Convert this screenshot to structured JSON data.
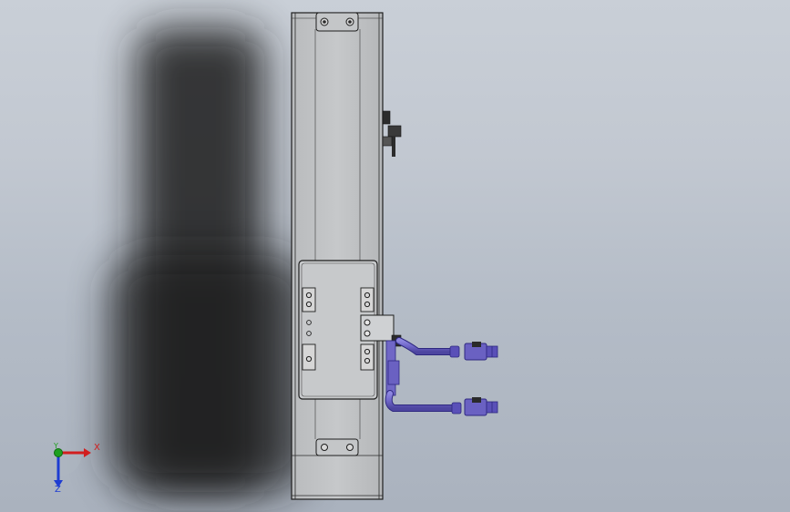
{
  "viewport": {
    "background_top": "#c9cfd7",
    "background_bottom": "#aab2be",
    "model": {
      "body_color": "#bfc1c3",
      "edge_color": "#1e1e1e",
      "cable_color": "#6f66c8",
      "connector_color": "#5a50b8"
    }
  },
  "triad": {
    "x_label": "X",
    "y_label": "Y",
    "z_label": "Z",
    "x_color": "#d21e1e",
    "y_color": "#1ea01e",
    "z_color": "#1e3cd2"
  }
}
